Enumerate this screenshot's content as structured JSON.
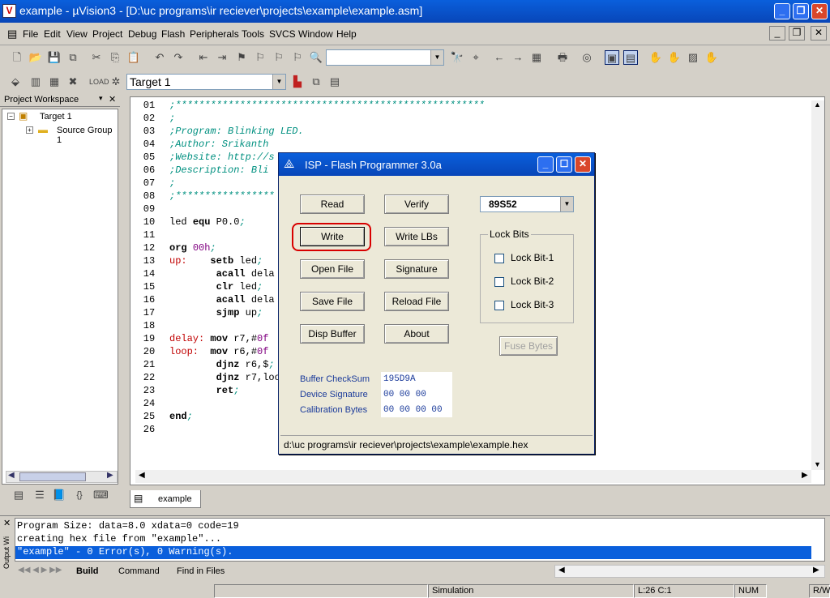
{
  "window": {
    "title": "example  - µVision3 - [D:\\uc programs\\ir reciever\\projects\\example\\example.asm]",
    "icon": "V"
  },
  "menu": [
    "File",
    "Edit",
    "View",
    "Project",
    "Debug",
    "Flash",
    "Peripherals",
    "Tools",
    "SVCS",
    "Window",
    "Help"
  ],
  "target": {
    "value": "Target 1"
  },
  "workspace": {
    "title": "Project Workspace",
    "root": "Target 1",
    "group": "Source Group 1"
  },
  "editor": {
    "tab": "example",
    "lines": [
      {
        "n": "01",
        "parts": [
          {
            "c": "cmt",
            "t": ";*****************************************************"
          }
        ]
      },
      {
        "n": "02",
        "parts": [
          {
            "c": "cmt",
            "t": ";"
          }
        ]
      },
      {
        "n": "03",
        "parts": [
          {
            "c": "cmt",
            "t": ";Program: Blinking LED."
          }
        ]
      },
      {
        "n": "04",
        "parts": [
          {
            "c": "cmt",
            "t": ";Author: Srikanth"
          }
        ]
      },
      {
        "n": "05",
        "parts": [
          {
            "c": "cmt",
            "t": ";Website: http://s"
          }
        ]
      },
      {
        "n": "06",
        "parts": [
          {
            "c": "cmt",
            "t": ";Description: Bli"
          }
        ]
      },
      {
        "n": "07",
        "parts": [
          {
            "c": "cmt",
            "t": ";"
          }
        ]
      },
      {
        "n": "08",
        "parts": [
          {
            "c": "cmt",
            "t": ";*****************"
          }
        ]
      },
      {
        "n": "09",
        "parts": []
      },
      {
        "n": "10",
        "parts": [
          {
            "c": "",
            "t": "led "
          },
          {
            "c": "kw",
            "t": "equ"
          },
          {
            "c": "",
            "t": " P0.0"
          },
          {
            "c": "cmt",
            "t": ";"
          }
        ]
      },
      {
        "n": "11",
        "parts": []
      },
      {
        "n": "12",
        "parts": [
          {
            "c": "kw",
            "t": "org"
          },
          {
            "c": "",
            "t": " "
          },
          {
            "c": "num",
            "t": "00h"
          },
          {
            "c": "cmt",
            "t": ";"
          }
        ]
      },
      {
        "n": "13",
        "parts": [
          {
            "c": "lbl",
            "t": "up:"
          },
          {
            "c": "",
            "t": "    "
          },
          {
            "c": "kw",
            "t": "setb"
          },
          {
            "c": "",
            "t": " led"
          },
          {
            "c": "cmt",
            "t": ";"
          }
        ]
      },
      {
        "n": "14",
        "parts": [
          {
            "c": "",
            "t": "        "
          },
          {
            "c": "kw",
            "t": "acall"
          },
          {
            "c": "",
            "t": " dela"
          }
        ]
      },
      {
        "n": "15",
        "parts": [
          {
            "c": "",
            "t": "        "
          },
          {
            "c": "kw",
            "t": "clr"
          },
          {
            "c": "",
            "t": " led"
          },
          {
            "c": "cmt",
            "t": ";"
          }
        ]
      },
      {
        "n": "16",
        "parts": [
          {
            "c": "",
            "t": "        "
          },
          {
            "c": "kw",
            "t": "acall"
          },
          {
            "c": "",
            "t": " dela"
          }
        ]
      },
      {
        "n": "17",
        "parts": [
          {
            "c": "",
            "t": "        "
          },
          {
            "c": "kw",
            "t": "sjmp"
          },
          {
            "c": "",
            "t": " up"
          },
          {
            "c": "cmt",
            "t": ";"
          }
        ]
      },
      {
        "n": "18",
        "parts": []
      },
      {
        "n": "19",
        "parts": [
          {
            "c": "lbl",
            "t": "delay:"
          },
          {
            "c": "",
            "t": " "
          },
          {
            "c": "kw",
            "t": "mov"
          },
          {
            "c": "",
            "t": " r7,#"
          },
          {
            "c": "num",
            "t": "0f"
          }
        ]
      },
      {
        "n": "20",
        "parts": [
          {
            "c": "lbl",
            "t": "loop:"
          },
          {
            "c": "",
            "t": "  "
          },
          {
            "c": "kw",
            "t": "mov"
          },
          {
            "c": "",
            "t": " r6,#"
          },
          {
            "c": "num",
            "t": "0f"
          }
        ]
      },
      {
        "n": "21",
        "parts": [
          {
            "c": "",
            "t": "        "
          },
          {
            "c": "kw",
            "t": "djnz"
          },
          {
            "c": "",
            "t": " r6,$"
          },
          {
            "c": "cmt",
            "t": ";"
          }
        ]
      },
      {
        "n": "22",
        "parts": [
          {
            "c": "",
            "t": "        "
          },
          {
            "c": "kw",
            "t": "djnz"
          },
          {
            "c": "",
            "t": " r7,loo"
          }
        ]
      },
      {
        "n": "23",
        "parts": [
          {
            "c": "",
            "t": "        "
          },
          {
            "c": "kw",
            "t": "ret"
          },
          {
            "c": "cmt",
            "t": ";"
          }
        ]
      },
      {
        "n": "24",
        "parts": []
      },
      {
        "n": "25",
        "parts": [
          {
            "c": "kw",
            "t": "end"
          },
          {
            "c": "cmt",
            "t": ";"
          }
        ]
      },
      {
        "n": "26",
        "parts": []
      }
    ]
  },
  "dialog": {
    "title": "ISP - Flash Programmer  3.0a",
    "buttons": {
      "read": "Read",
      "verify": "Verify",
      "write": "Write",
      "write_lbs": "Write LBs",
      "open_file": "Open File",
      "signature": "Signature",
      "save_file": "Save File",
      "reload_file": "Reload File",
      "disp_buffer": "Disp Buffer",
      "about": "About",
      "fuse_bytes": "Fuse Bytes"
    },
    "device": "89S52",
    "lock_bits": {
      "title": "Lock Bits",
      "items": [
        "Lock Bit-1",
        "Lock Bit-2",
        "Lock Bit-3"
      ]
    },
    "info": {
      "checksum_label": "Buffer CheckSum",
      "checksum": "195D9A",
      "signature_label": "Device Signature",
      "signature": "00  00  00",
      "calibration_label": "Calibration Bytes",
      "calibration": "00  00  00  00"
    },
    "path": "d:\\uc programs\\ir reciever\\projects\\example\\example.hex"
  },
  "output": {
    "lines": [
      "Program Size: data=8.0 xdata=0 code=19",
      "creating hex file from \"example\"...",
      "\"example\" - 0 Error(s), 0 Warning(s)."
    ],
    "side_label": "Output Wi",
    "tabs": [
      "Build",
      "Command",
      "Find in Files"
    ]
  },
  "status": {
    "mode": "Simulation",
    "pos": "L:26 C:1",
    "num": "NUM",
    "rw": "R/W"
  },
  "colors": {
    "titlebar": "#0a5fdc",
    "selection": "#0a5fdc",
    "highlight": "#cc0000"
  }
}
